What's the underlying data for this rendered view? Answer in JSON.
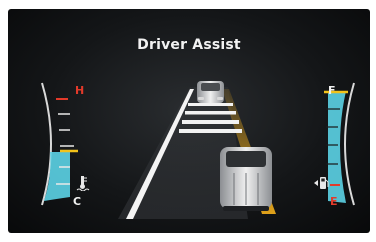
{
  "screen": {
    "title": "Driver Assist"
  },
  "temperature_gauge": {
    "high_label": "H",
    "low_label": "C",
    "level": 0.37,
    "icon": "coolant-temperature-icon"
  },
  "fuel_gauge": {
    "full_label": "F",
    "empty_label": "E",
    "level": 0.93,
    "icon": "fuel-pump-icon"
  },
  "colors": {
    "red": "#e23a2a",
    "yellow": "#f2c21a",
    "cyan": "#5cd3e6",
    "lane_highlight": "#e9a81a"
  }
}
